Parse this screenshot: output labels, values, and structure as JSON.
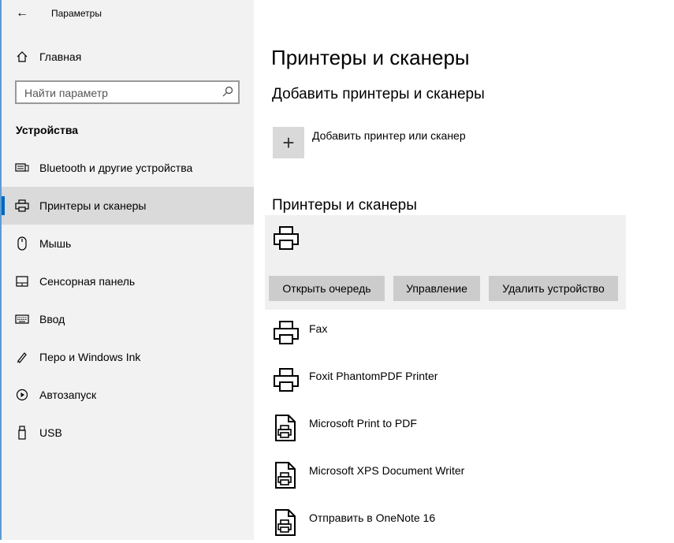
{
  "window": {
    "title": "Параметры",
    "back_glyph": "←"
  },
  "sidebar": {
    "home_label": "Главная",
    "search_placeholder": "Найти параметр",
    "section_title": "Устройства",
    "items": [
      {
        "label": "Bluetooth и другие устройства",
        "icon": "bluetooth-devices-icon"
      },
      {
        "label": "Принтеры и сканеры",
        "icon": "printer-icon",
        "selected": true
      },
      {
        "label": "Мышь",
        "icon": "mouse-icon"
      },
      {
        "label": "Сенсорная панель",
        "icon": "touchpad-icon"
      },
      {
        "label": "Ввод",
        "icon": "keyboard-icon"
      },
      {
        "label": "Перо и Windows Ink",
        "icon": "pen-icon"
      },
      {
        "label": "Автозапуск",
        "icon": "autoplay-icon"
      },
      {
        "label": "USB",
        "icon": "usb-icon"
      }
    ]
  },
  "main": {
    "page_title": "Принтеры и сканеры",
    "add_section_title": "Добавить принтеры и сканеры",
    "add_button_label": "Добавить принтер или сканер",
    "add_glyph": "+",
    "list_section_title": "Принтеры и сканеры",
    "selected_device": {
      "name": "",
      "buttons": {
        "open_queue": "Открыть очередь",
        "manage": "Управление",
        "remove": "Удалить устройство"
      }
    },
    "devices": [
      {
        "name": "Fax",
        "icon": "printer-icon"
      },
      {
        "name": "Foxit PhantomPDF Printer",
        "icon": "printer-icon"
      },
      {
        "name": "Microsoft Print to PDF",
        "icon": "document-printer-icon"
      },
      {
        "name": "Microsoft XPS Document Writer",
        "icon": "document-printer-icon"
      },
      {
        "name": "Отправить в OneNote 16",
        "icon": "document-printer-icon"
      }
    ]
  },
  "colors": {
    "accent": "#0067c0",
    "sidebar_bg": "#f2f2f2",
    "selected_bg": "#dadada",
    "button_bg": "#cccccc"
  }
}
